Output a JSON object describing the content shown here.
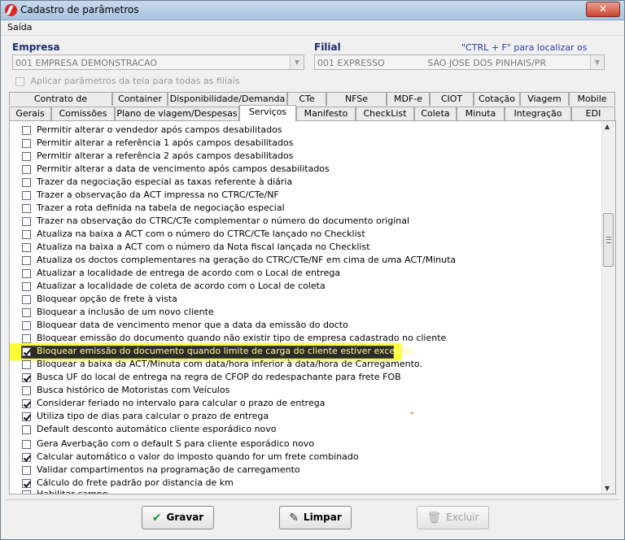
{
  "window": {
    "title": "Cadastro de parâmetros",
    "close_glyph": "✕"
  },
  "menu": {
    "saida": "Saída"
  },
  "empresa": {
    "label": "Empresa",
    "value": "001 EMPRESA DEMONSTRACAO"
  },
  "filial": {
    "label": "Filial",
    "value": "001 EXPRESSO               SAO JOSE DOS PINHAIS/PR"
  },
  "hint": "\"CTRL + F\" para localizar os campos",
  "apply_all": "Aplicar parâmetros da tela para todas as filiais",
  "tabs_row1": [
    "Contrato de transporte",
    "Container",
    "Disponibilidade/Demanda",
    "CTe",
    "NFSe",
    "MDF-e",
    "CIOT",
    "Cotação",
    "Viagem",
    "Mobile"
  ],
  "tabs_row2": [
    "Gerais",
    "Comissões",
    "Plano de viagem/Despesas",
    "Serviços",
    "Manifesto",
    "CheckList",
    "Coleta",
    "Minuta",
    "Integração",
    "EDI"
  ],
  "active_tab": "Serviços",
  "items": [
    {
      "label": "Permitir alterar o vendedor após campos desabilitados",
      "checked": false
    },
    {
      "label": "Permitir alterar a referência 1 após campos desabilitados",
      "checked": false
    },
    {
      "label": "Permitir alterar a referência 2 após campos desabilitados",
      "checked": false
    },
    {
      "label": "Permitir alterar a data de vencimento após campos desabilitados",
      "checked": false
    },
    {
      "label": "Trazer da negociação especial as taxas referente à diária",
      "checked": false
    },
    {
      "label": "Trazer a observação da ACT impressa no CTRC/CTe/NF",
      "checked": false
    },
    {
      "label": "Trazer a rota definida na tabela de negociação especial",
      "checked": false
    },
    {
      "label": "Trazer na observação do CTRC/CTe complementar o número do documento original",
      "checked": false
    },
    {
      "label": "Atualiza na baixa a ACT com o número do CTRC/CTe lançado no Checklist",
      "checked": false
    },
    {
      "label": "Atualiza na baixa a ACT com o número da Nota fiscal lançada no Checklist",
      "checked": false
    },
    {
      "label": "Atualiza os doctos complementares na geração do CTRC/CTe/NF em cima de uma ACT/Minuta",
      "checked": false
    },
    {
      "label": "Atualizar a localidade de entrega de acordo com o Local de entrega",
      "checked": false
    },
    {
      "label": "Atualizar a localidade de coleta de acordo com o Local de coleta",
      "checked": false
    },
    {
      "label": "Bloquear opção de frete à vista",
      "checked": false
    },
    {
      "label": "Bloquear a inclusão de um novo cliente",
      "checked": false
    },
    {
      "label": "Bloquear data de vencimento menor que a data da emissão do docto",
      "checked": false
    },
    {
      "label": "Bloquear emissão do documento quando não existir tipo de empresa cadastrado no cliente",
      "checked": false
    },
    {
      "label": "Bloquear emissão do documento quando limite de carga do cliente estiver excedido",
      "checked": true
    },
    {
      "label": "Bloquear a baixa da ACT/Minuta com data/hora inferior à data/hora de Carregamento.",
      "checked": false
    },
    {
      "label": "Busca UF do local de entrega na regra de CFOP do redespachante para frete FOB",
      "checked": true
    },
    {
      "label": "Busca histórico de Motoristas com Veículos",
      "checked": false
    },
    {
      "label": "Considerar feriado no intervalo para calcular o prazo de entrega",
      "checked": true
    },
    {
      "label": "Utiliza tipo de dias para calcular o prazo de entrega",
      "checked": true
    },
    {
      "label": "Default desconto automático cliente esporádico novo",
      "checked": false
    },
    {
      "label": "Gera Averbação com o default S para cliente esporádico novo",
      "checked": false
    },
    {
      "label": "Calcular automático o valor do imposto quando for um frete combinado",
      "checked": true
    },
    {
      "label": "Validar compartimentos na programação de carregamento",
      "checked": false
    },
    {
      "label": "Cálculo do frete padrão por distancia de km",
      "checked": true
    },
    {
      "label": "Habilitar campo ... ",
      "checked": false
    }
  ],
  "buttons": {
    "gravar": "Gravar",
    "limpar": "Limpar",
    "excluir": "Excluir"
  },
  "colors": {
    "highlight": "#ffff33",
    "check_green": "#1a9a2a"
  }
}
